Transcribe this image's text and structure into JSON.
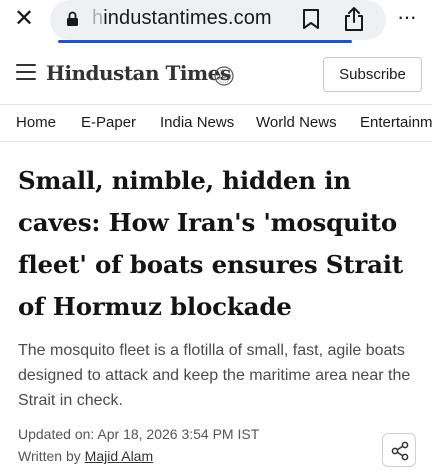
{
  "browser": {
    "close_glyph": "✕",
    "url_dim": "h",
    "url_main": "industantimes.com",
    "more_glyph": "···"
  },
  "site": {
    "logo": "Hindustan Times",
    "badge": "100",
    "subscribe_label": "Subscribe"
  },
  "nav": {
    "items": [
      "Home",
      "E-Paper",
      "India News",
      "World News",
      "Entertainme"
    ]
  },
  "article": {
    "headline": "Small, nimble, hidden in caves: How Iran's 'mosquito fleet' of boats ensures Strait of Hormuz blockade",
    "summary": "The mosquito fleet is a flotilla of small, fast, agile boats designed to attack and keep the maritime area near the Strait in check.",
    "updated": "Updated on: Apr 18, 2026 3:54 PM IST",
    "byline_prefix": "Written by ",
    "author": "Majid Alam"
  },
  "colors": {
    "progress": "#1b56c8",
    "url_bar": "#eef0f4"
  }
}
